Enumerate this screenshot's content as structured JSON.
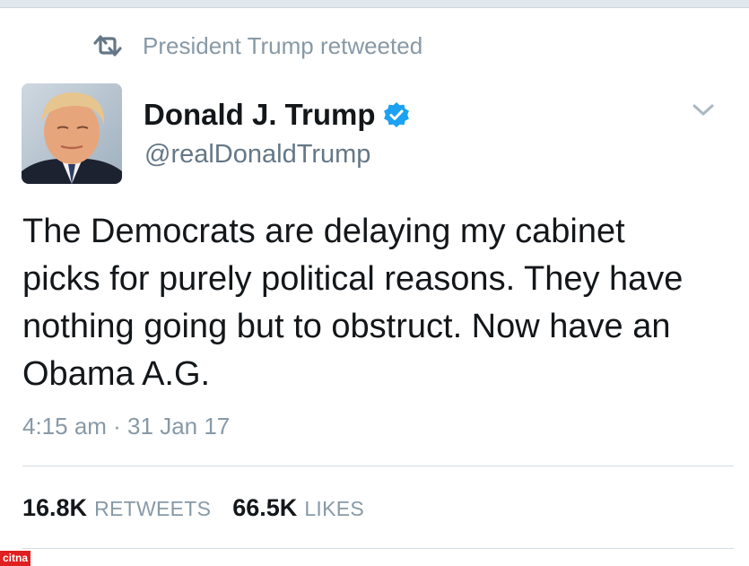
{
  "retweet_header": {
    "icon": "retweet-icon",
    "text": "President Trump retweeted"
  },
  "author": {
    "avatar": "avatar",
    "display_name": "Donald J. Trump",
    "verified": true,
    "verified_icon": "verified-badge-icon",
    "handle": "@realDonaldTrump",
    "menu_icon": "chevron-down-icon"
  },
  "tweet": {
    "lines": [
      "The Democrats are delaying my cabinet",
      "picks for purely political reasons. They have",
      "nothing going but to obstruct. Now have an",
      "Obama A.G."
    ],
    "timestamp": "4:15 am · 31 Jan 17"
  },
  "stats": {
    "retweets_count": "16.8K",
    "retweets_label": "RETWEETS",
    "likes_count": "66.5K",
    "likes_label": "LIKES"
  },
  "watermark": {
    "text": "citna"
  },
  "colors": {
    "primary_text": "#14171a",
    "secondary_text": "#8899a6",
    "verified_blue": "#1da1f2",
    "divider": "#d5dde3",
    "watermark_red": "#e02020"
  }
}
